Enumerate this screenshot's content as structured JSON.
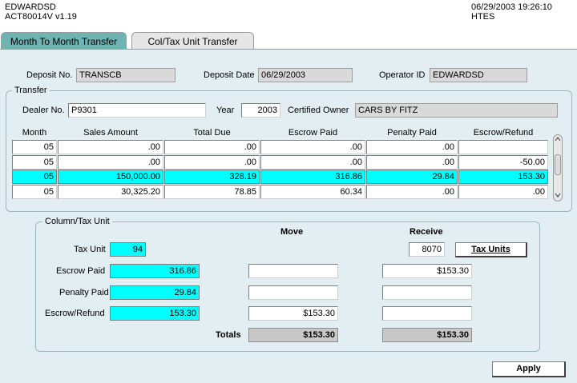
{
  "header": {
    "user": "EDWARDSD",
    "app_version": "ACT80014V v1.19",
    "datetime": "06/29/2003 19:26:10",
    "system": "HTES"
  },
  "tabs": [
    {
      "label": "Month To Month Transfer",
      "active": true
    },
    {
      "label": "Col/Tax Unit Transfer",
      "active": false
    }
  ],
  "deposit": {
    "deposit_no_label": "Deposit No.",
    "deposit_no": "TRANSCB",
    "deposit_date_label": "Deposit Date",
    "deposit_date": "06/29/2003",
    "operator_id_label": "Operator ID",
    "operator_id": "EDWARDSD"
  },
  "transfer": {
    "title": "Transfer",
    "dealer_no_label": "Dealer No.",
    "dealer_no": "P9301",
    "year_label": "Year",
    "year": "2003",
    "certified_owner_label": "Certified Owner",
    "certified_owner": "CARS BY FITZ",
    "columns": [
      "Month",
      "Sales Amount",
      "Total Due",
      "Escrow Paid",
      "Penalty Paid",
      "Escrow/Refund"
    ],
    "rows": [
      {
        "month": "05",
        "sales_amount": ".00",
        "total_due": ".00",
        "escrow_paid": ".00",
        "penalty_paid": ".00",
        "escrow_refund": "",
        "selected": false
      },
      {
        "month": "05",
        "sales_amount": ".00",
        "total_due": ".00",
        "escrow_paid": ".00",
        "penalty_paid": ".00",
        "escrow_refund": "-50.00",
        "selected": false
      },
      {
        "month": "05",
        "sales_amount": "150,000.00",
        "total_due": "328.19",
        "escrow_paid": "316.86",
        "penalty_paid": "29.84",
        "escrow_refund": "153.30",
        "selected": true
      },
      {
        "month": "05",
        "sales_amount": "30,325.20",
        "total_due": "78.85",
        "escrow_paid": "60.34",
        "penalty_paid": ".00",
        "escrow_refund": ".00",
        "selected": false
      }
    ]
  },
  "col_tax_unit": {
    "title": "Column/Tax Unit",
    "move_header": "Move",
    "receive_header": "Receive",
    "tax_unit_label": "Tax Unit",
    "tax_unit": "94",
    "receive_tax_unit": "8070",
    "tax_units_button": "Tax Units",
    "escrow_paid_label": "Escrow Paid",
    "escrow_paid": "316.86",
    "escrow_paid_move": "",
    "escrow_paid_receive": "$153.30",
    "penalty_paid_label": "Penalty Paid",
    "penalty_paid": "29.84",
    "penalty_paid_move": "",
    "penalty_paid_receive": "",
    "escrow_refund_label": "Escrow/Refund",
    "escrow_refund": "153.30",
    "escrow_refund_move": "$153.30",
    "escrow_refund_receive": "",
    "totals_label": "Totals",
    "totals_move": "$153.30",
    "totals_receive": "$153.30"
  },
  "apply_button": "Apply",
  "colors": {
    "selected_row": "#00ffff",
    "active_tab": "#6fb3b3",
    "panel_background": "#e2eef1"
  }
}
